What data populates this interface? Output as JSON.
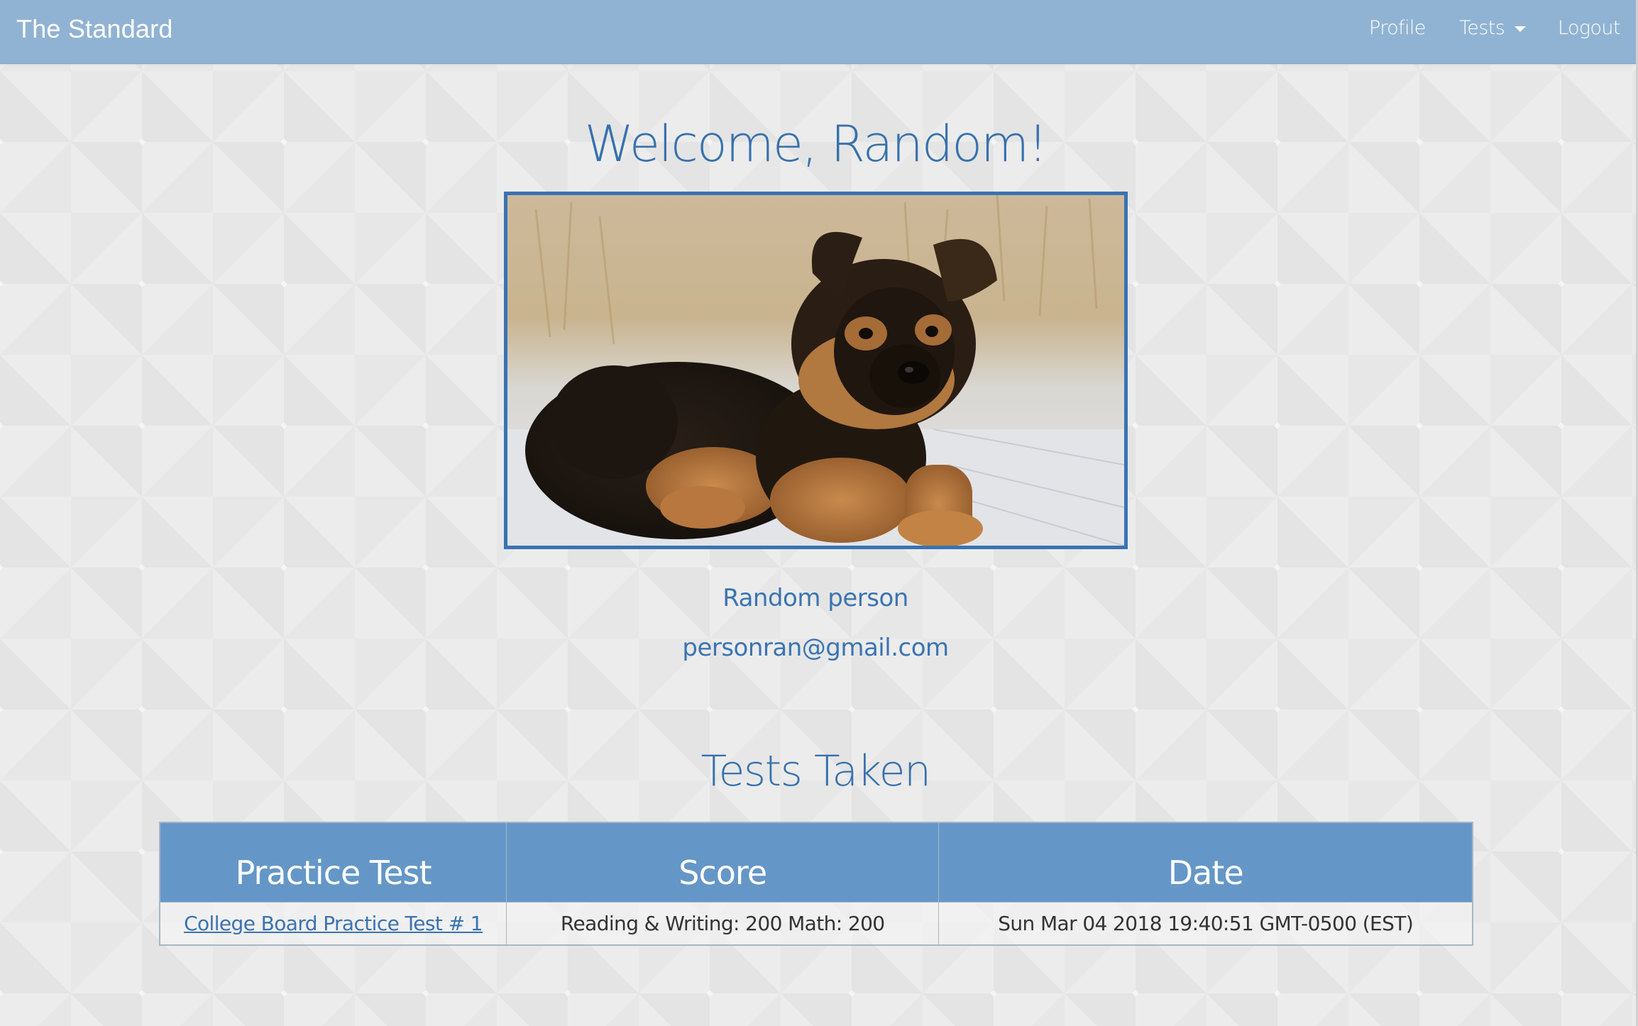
{
  "navbar": {
    "brand": "The Standard",
    "links": {
      "profile": "Profile",
      "tests": "Tests",
      "logout": "Logout"
    },
    "background_color": "#91b3d3"
  },
  "main": {
    "welcome_heading": "Welcome, Random!",
    "photo": {
      "icon": "puppy-photo",
      "border_color": "#3973b3"
    },
    "user": {
      "name": "Random person",
      "email": "personran@gmail.com"
    },
    "tests_heading": "Tests Taken",
    "tests_table": {
      "columns": [
        "Practice Test",
        "Score",
        "Date"
      ],
      "header_color": "#6497c7",
      "rows": [
        {
          "practice_test": "College Board Practice Test # 1",
          "score": "Reading & Writing: 200 Math: 200",
          "date": "Sun Mar 04 2018 19:40:51 GMT-0500 (EST)"
        }
      ]
    }
  },
  "accent_color": "#3771ad"
}
